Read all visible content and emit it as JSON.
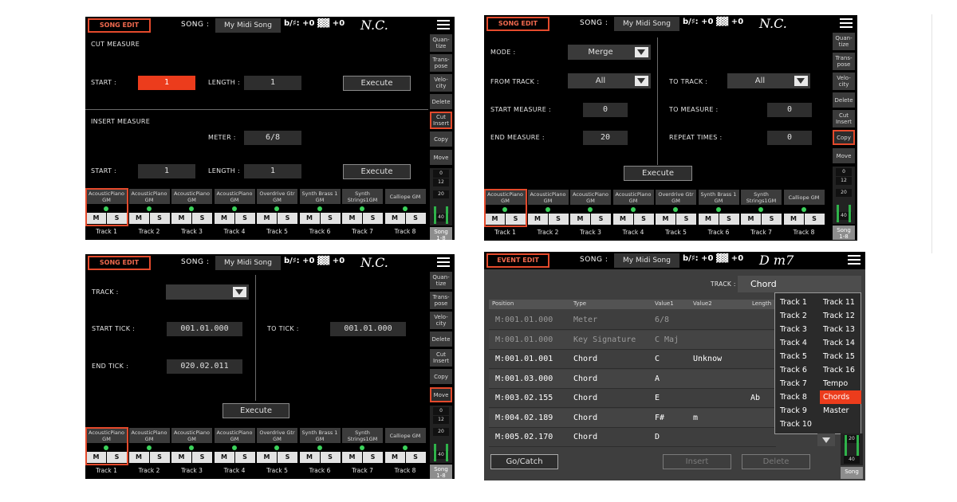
{
  "common": {
    "song_label": "SONG :",
    "song_name": "My Midi Song",
    "transpose": "b/♯: +0  ▓▓ +0",
    "chord_nc": "N.C.",
    "chord_dm7": "D m7",
    "song_edit": "SONG EDIT",
    "event_edit": "EVENT EDIT"
  },
  "sidebar": {
    "quantize": "Quan-\ntize",
    "transpose": "Trans-\npose",
    "velocity": "Velo-\ncity",
    "delete": "Delete",
    "cut_insert": "Cut\nInsert",
    "copy": "Copy",
    "move": "Move",
    "meter": [
      "0",
      "12",
      "20",
      "40"
    ],
    "song18": "Song\n1-8",
    "song": "Song"
  },
  "tracks": [
    {
      "name": "AcousticPiano GM",
      "label": "Track 1"
    },
    {
      "name": "AcousticPiano GM",
      "label": "Track 2"
    },
    {
      "name": "AcousticPiano GM",
      "label": "Track 3"
    },
    {
      "name": "AcousticPiano GM",
      "label": "Track 4"
    },
    {
      "name": "Overdrive Gtr GM",
      "label": "Track 5"
    },
    {
      "name": "Synth Brass 1 GM",
      "label": "Track 6"
    },
    {
      "name": "Synth Strings1GM",
      "label": "Track 7"
    },
    {
      "name": "Calliope GM",
      "label": "Track 8"
    }
  ],
  "track_buttons": {
    "m": "M",
    "s": "S"
  },
  "cut_insert": {
    "cut_title": "CUT MEASURE",
    "start_label": "START :",
    "start_value": "1",
    "length_label": "LENGTH :",
    "length_value": "1",
    "execute": "Execute",
    "insert_title": "INSERT MEASURE",
    "meter_label": "METER :",
    "meter_value": "6/8",
    "insert_start_value": "1",
    "insert_length_value": "1",
    "insert_execute": "Execute"
  },
  "copy": {
    "mode_label": "MODE :",
    "mode_value": "Merge",
    "from_track_label": "FROM TRACK :",
    "from_track_value": "All",
    "to_track_label": "TO TRACK :",
    "to_track_value": "All",
    "start_measure_label": "START MEASURE :",
    "start_measure_value": "0",
    "to_measure_label": "TO MEASURE :",
    "to_measure_value": "0",
    "end_measure_label": "END MEASURE :",
    "end_measure_value": "20",
    "repeat_label": "REPEAT TIMES :",
    "repeat_value": "0",
    "execute": "Execute"
  },
  "move": {
    "track_label": "TRACK :",
    "track_value": "",
    "start_tick_label": "START TICK :",
    "start_tick_value": "001.01.000",
    "to_tick_label": "TO TICK :",
    "to_tick_value": "001.01.000",
    "end_tick_label": "END TICK :",
    "end_tick_value": "020.02.011",
    "execute": "Execute"
  },
  "event_edit": {
    "track_label": "TRACK :",
    "track_value": "Chord",
    "columns": [
      "Position",
      "Type",
      "Value1",
      "Value2",
      "Length"
    ],
    "rows": [
      {
        "pos": "M:001.01.000",
        "type": "Meter",
        "v1": "6/8",
        "v2": "",
        "len": "",
        "dim": true
      },
      {
        "pos": "M:001.01.000",
        "type": "Key Signature",
        "v1": "C Maj",
        "v2": "",
        "len": "",
        "dim": true
      },
      {
        "pos": "M:001.01.001",
        "type": "Chord",
        "v1": "C",
        "v2": "Unknow",
        "len": "",
        "dim": false
      },
      {
        "pos": "M:001.03.000",
        "type": "Chord",
        "v1": "A",
        "v2": "",
        "len": "",
        "dim": false
      },
      {
        "pos": "M:003.02.155",
        "type": "Chord",
        "v1": "E",
        "v2": "",
        "len": "Ab",
        "dim": false
      },
      {
        "pos": "M:004.02.189",
        "type": "Chord",
        "v1": "F#",
        "v2": "m",
        "len": "",
        "dim": false
      },
      {
        "pos": "M:005.02.170",
        "type": "Chord",
        "v1": "D",
        "v2": "",
        "len": "",
        "dim": false
      }
    ],
    "popup_left": [
      "Track 1",
      "Track 2",
      "Track 3",
      "Track 4",
      "Track 5",
      "Track 6",
      "Track 7",
      "Track 8",
      "Track 9",
      "Track 10"
    ],
    "popup_right": [
      "Track 11",
      "Track 12",
      "Track 13",
      "Track 14",
      "Track 15",
      "Track 16",
      "Tempo",
      "Chords",
      "Master"
    ],
    "popup_selected": "Chords",
    "go_catch": "Go/Catch",
    "insert": "Insert",
    "delete": "Delete"
  }
}
